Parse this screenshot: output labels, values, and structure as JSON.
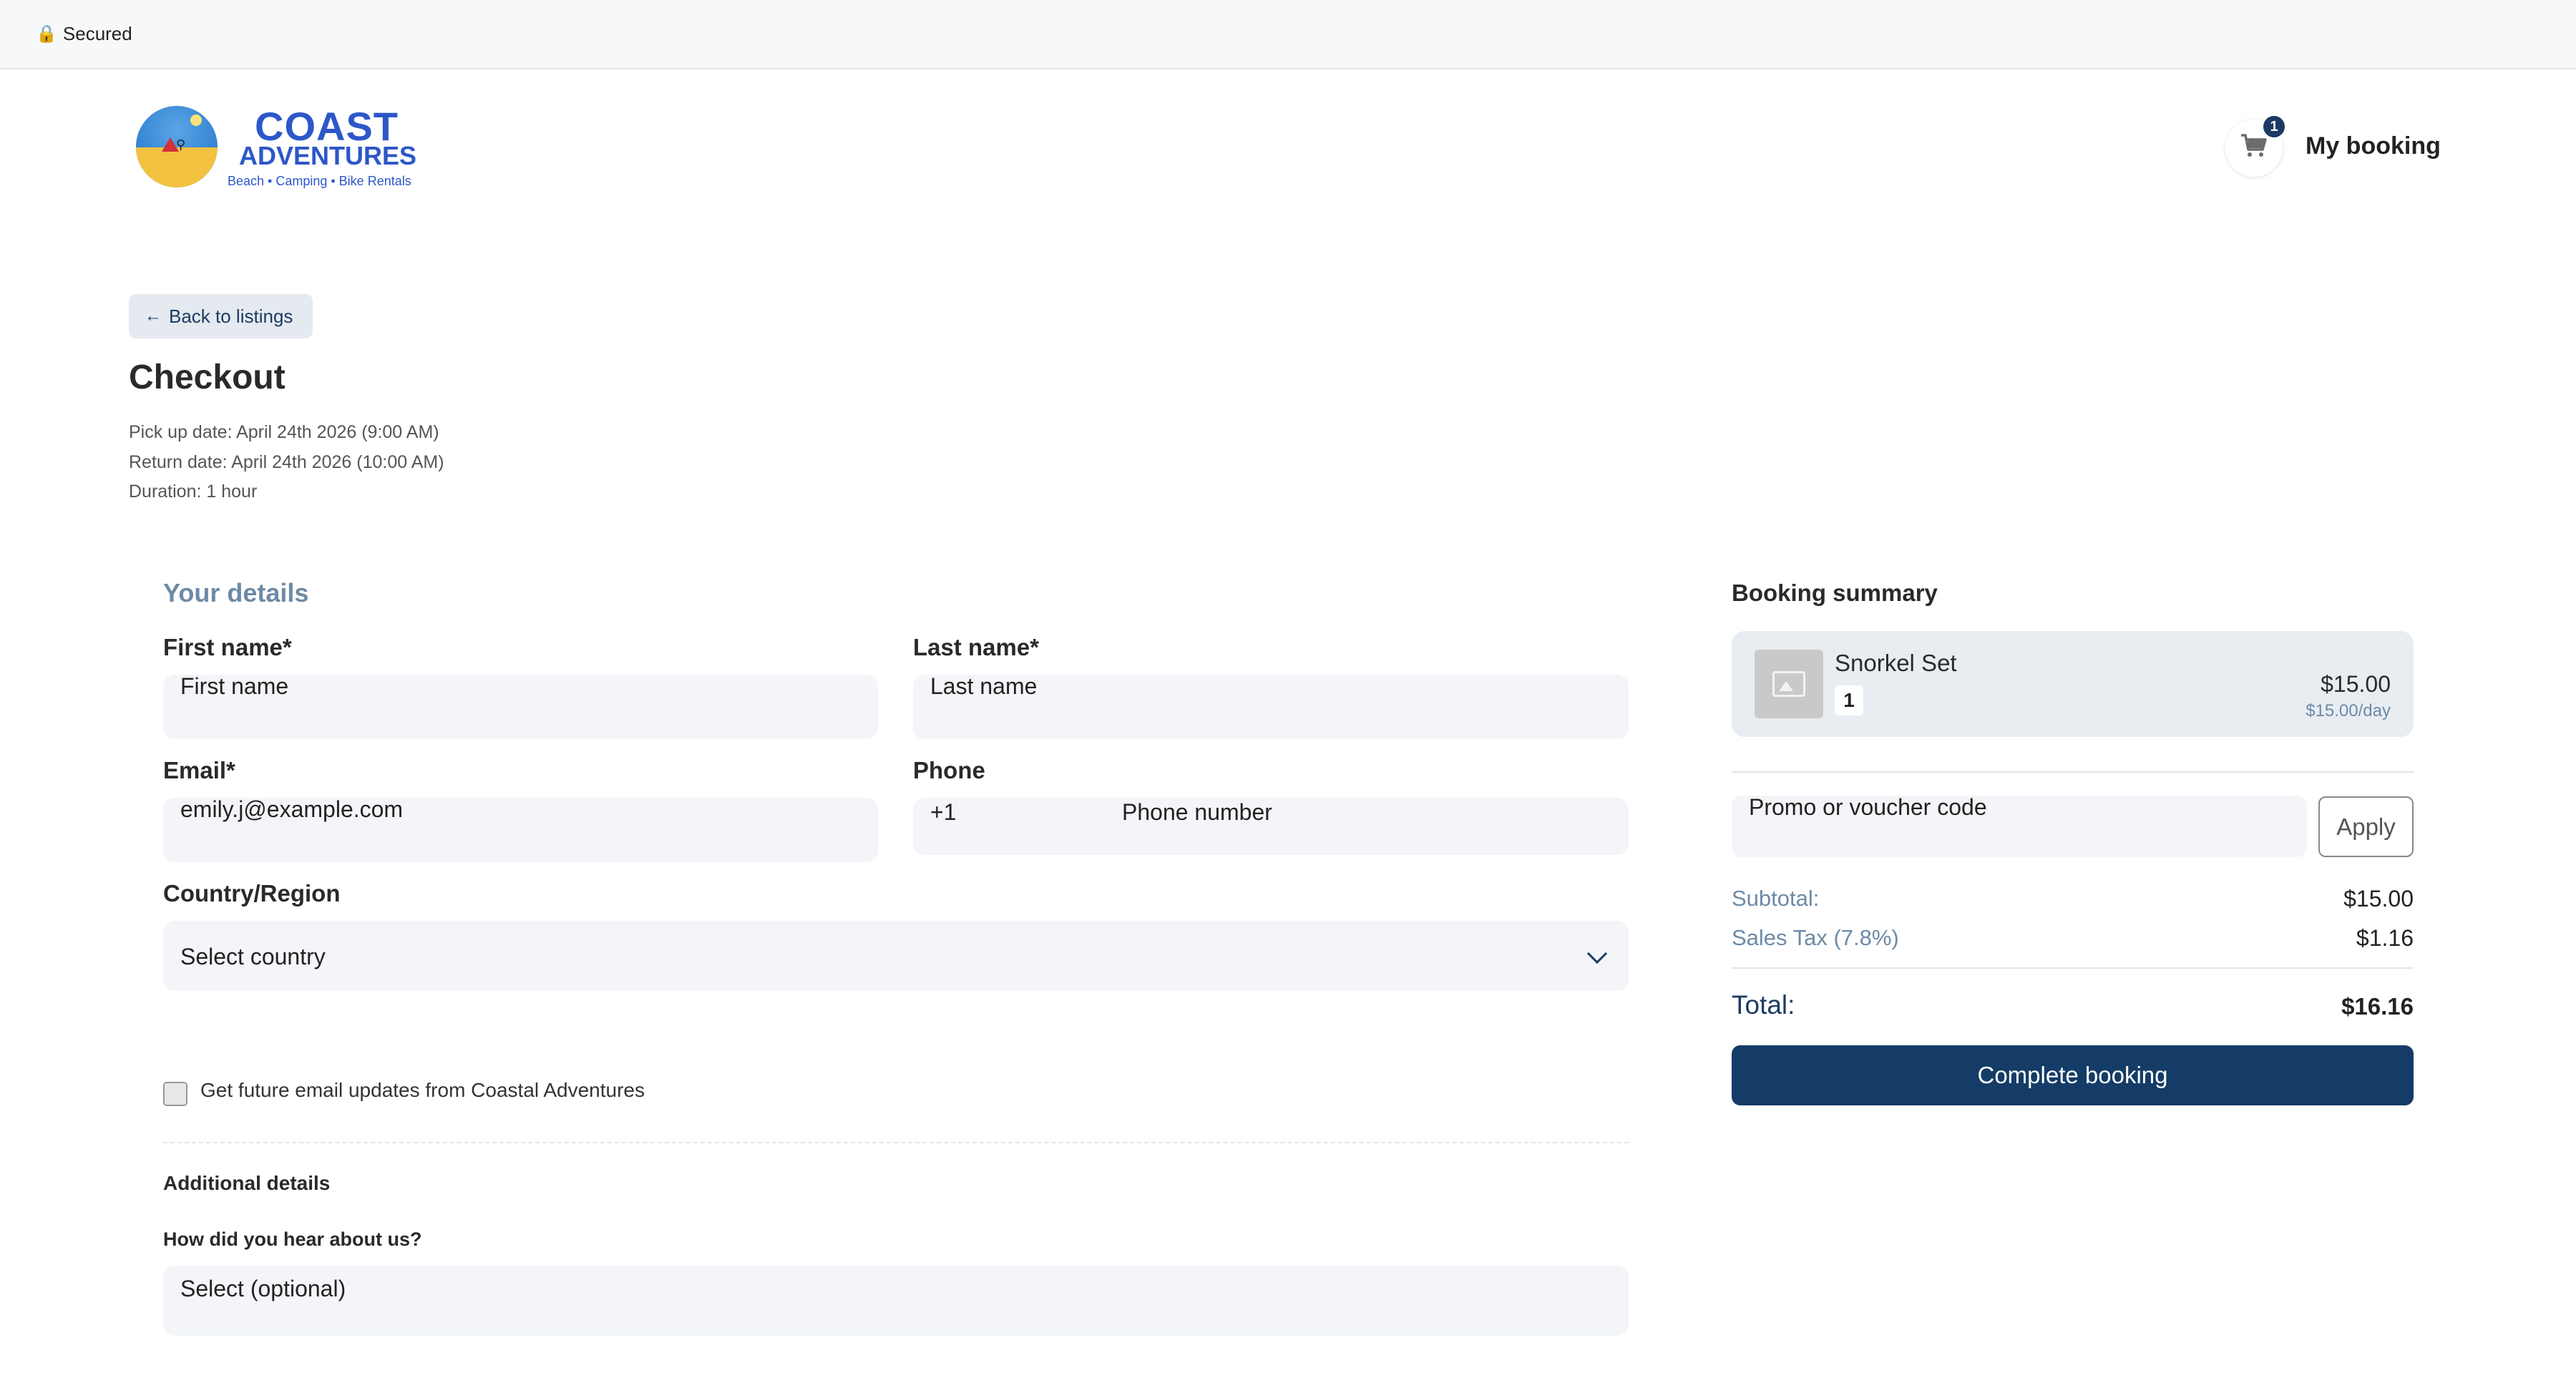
{
  "topbar": {
    "lock_icon": "🔒",
    "secured": "Secured"
  },
  "logo": {
    "name": "COAST",
    "name2": "ADVENTURES",
    "tagline": "Beach • Camping • Bike Rentals"
  },
  "header": {
    "cart_count": "1",
    "my_booking": "My booking"
  },
  "nav": {
    "back": "Back to listings",
    "back_arrow": "←"
  },
  "page": {
    "title": "Checkout",
    "pickup": "Pick up date: April 24th 2026 (9:00 AM)",
    "return": "Return date: April 24th 2026 (10:00 AM)",
    "duration": "Duration: 1 hour"
  },
  "details": {
    "title": "Your details",
    "first_name_label": "First name*",
    "first_name_placeholder": "First name",
    "last_name_label": "Last name*",
    "last_name_placeholder": "Last name",
    "email_label": "Email*",
    "email_value": "emily.j@example.com",
    "phone_label": "Phone",
    "phone_code": "+1",
    "phone_placeholder": "Phone number",
    "country_label": "Country/Region",
    "country_value": "Select country",
    "newsletter_label": "Get future email updates from Coastal Adventures",
    "additional_title": "Additional details",
    "hear_label": "How did you hear about us?",
    "hear_value": "Select (optional)"
  },
  "summary": {
    "title": "Booking summary",
    "item_name": "Snorkel Set",
    "item_qty": "1",
    "item_price": "$15.00",
    "item_rate": "$15.00/day",
    "promo_placeholder": "Promo or voucher code",
    "apply": "Apply",
    "subtotal_label": "Subtotal:",
    "subtotal_value": "$15.00",
    "tax_label": "Sales Tax (7.8%)",
    "tax_value": "$1.16",
    "total_label": "Total:",
    "total_value": "$16.16",
    "complete": "Complete booking"
  },
  "colors": {
    "primary": "#143c66",
    "accent": "#6d8aa6",
    "brand": "#2d57c9"
  }
}
